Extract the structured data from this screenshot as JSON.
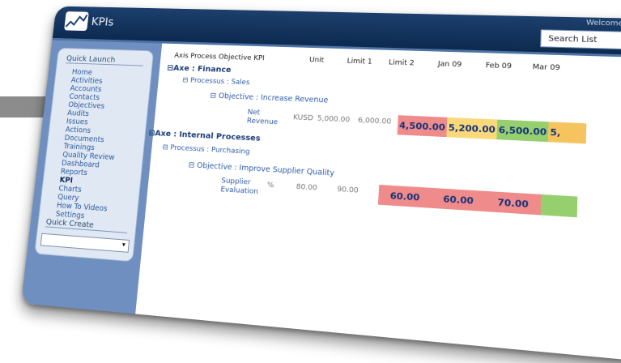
{
  "header": {
    "logo_text": "KPIs",
    "welcome": "Welcome Boris",
    "search_label": "Search List"
  },
  "sidebar": {
    "quick_launch_title": "Quick Launch",
    "items": [
      {
        "label": "Home"
      },
      {
        "label": "Activities"
      },
      {
        "label": "Accounts"
      },
      {
        "label": "Contacts"
      },
      {
        "label": "Objectives"
      },
      {
        "label": "Audits"
      },
      {
        "label": "Issues"
      },
      {
        "label": "Actions"
      },
      {
        "label": "Documents"
      },
      {
        "label": "Trainings"
      },
      {
        "label": "Quality Review"
      },
      {
        "label": "Dashboard"
      },
      {
        "label": "Reports"
      },
      {
        "label": "KPI"
      },
      {
        "label": "Charts"
      },
      {
        "label": "Query"
      },
      {
        "label": "How To Videos"
      },
      {
        "label": "Settings"
      }
    ],
    "active_item": "KPI",
    "quick_create_title": "Quick Create"
  },
  "table": {
    "columns": [
      "Axis Process Objective KPI",
      "Unit",
      "Limit 1",
      "Limit 2",
      "Jan 09",
      "Feb 09",
      "Mar 09"
    ],
    "axes": [
      {
        "axe_label": "Axe : Finance",
        "process_label": "Processus : Sales",
        "objective_label": "Objective : Increase Revenue",
        "kpi": {
          "name_line1": "Net",
          "name_line2": "Revenue",
          "unit": "KUSD",
          "limit1": "5,000.00",
          "limit2": "6,000.00",
          "values": [
            {
              "text": "4,500.00",
              "status": "red"
            },
            {
              "text": "5,200.00",
              "status": "yellow"
            },
            {
              "text": "6,500.00",
              "status": "green"
            },
            {
              "text": "5,",
              "status": "orange"
            }
          ]
        }
      },
      {
        "axe_label": "Axe : Internal Processes",
        "process_label": "Processus : Purchasing",
        "objective_label": "Objective : Improve Supplier Quality",
        "kpi": {
          "name_line1": "Supplier",
          "name_line2": "Evaluation",
          "unit": "%",
          "limit1": "80.00",
          "limit2": "90.00",
          "values": [
            {
              "text": "60.00",
              "status": "red"
            },
            {
              "text": "60.00",
              "status": "red"
            },
            {
              "text": "70.00",
              "status": "red"
            },
            {
              "text": "",
              "status": "green"
            }
          ]
        }
      }
    ]
  },
  "colors": {
    "red": "#f08b8b",
    "yellow": "#f9d97a",
    "green": "#96cf6e",
    "orange": "#f6c45f",
    "topbar": "#0d2a50",
    "sidebar": "#6f8fc0"
  }
}
